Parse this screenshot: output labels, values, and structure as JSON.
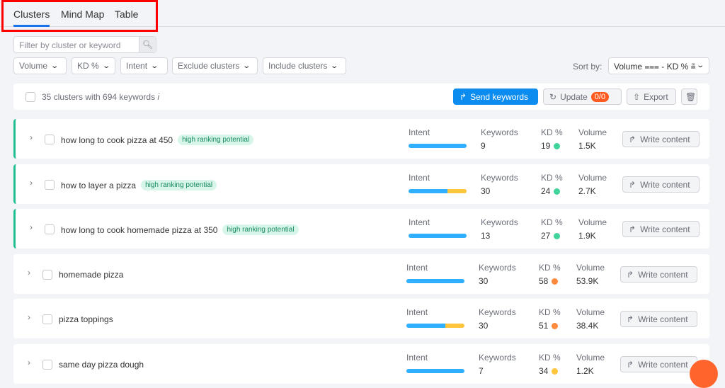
{
  "tabs": [
    "Clusters",
    "Mind Map",
    "Table"
  ],
  "search": {
    "placeholder": "Filter by cluster or keyword"
  },
  "filters": [
    "Volume",
    "KD %",
    "Intent",
    "Exclude clusters",
    "Include clusters"
  ],
  "sort": {
    "label": "Sort by:",
    "value": "Volume ⩶ - KD % ≞"
  },
  "summary": "35 clusters with 694 keywords",
  "actions": {
    "send": "Send keywords",
    "update": "Update",
    "update_badge": "0/0",
    "export": "Export"
  },
  "columns": {
    "intent": "Intent",
    "keywords": "Keywords",
    "kd": "KD %",
    "volume": "Volume"
  },
  "write_label": "Write content",
  "rows": [
    {
      "name": "how long to cook pizza at 450",
      "tag": "high ranking potential",
      "keywords": "9",
      "kd": "19",
      "kd_color": "#3ed49a",
      "volume": "1.5K",
      "intent": [
        1,
        0
      ]
    },
    {
      "name": "how to layer a pizza",
      "tag": "high ranking potential",
      "keywords": "30",
      "kd": "24",
      "kd_color": "#3ed49a",
      "volume": "2.7K",
      "intent": [
        0.67,
        0.33
      ]
    },
    {
      "name": "how long to cook homemade pizza at 350",
      "tag": "high ranking potential",
      "keywords": "13",
      "kd": "27",
      "kd_color": "#3ed49a",
      "volume": "1.9K",
      "intent": [
        1,
        0
      ]
    },
    {
      "name": "homemade pizza",
      "tag": "",
      "keywords": "30",
      "kd": "58",
      "kd_color": "#ff8a3d",
      "volume": "53.9K",
      "intent": [
        1,
        0
      ]
    },
    {
      "name": "pizza toppings",
      "tag": "",
      "keywords": "30",
      "kd": "51",
      "kd_color": "#ff8a3d",
      "volume": "38.4K",
      "intent": [
        0.67,
        0.33
      ]
    },
    {
      "name": "same day pizza dough",
      "tag": "",
      "keywords": "7",
      "kd": "34",
      "kd_color": "#ffc53d",
      "volume": "1.2K",
      "intent": [
        1,
        0
      ]
    }
  ],
  "colors": {
    "informational": "#2eb0ff",
    "commercial": "#ffc53d"
  }
}
